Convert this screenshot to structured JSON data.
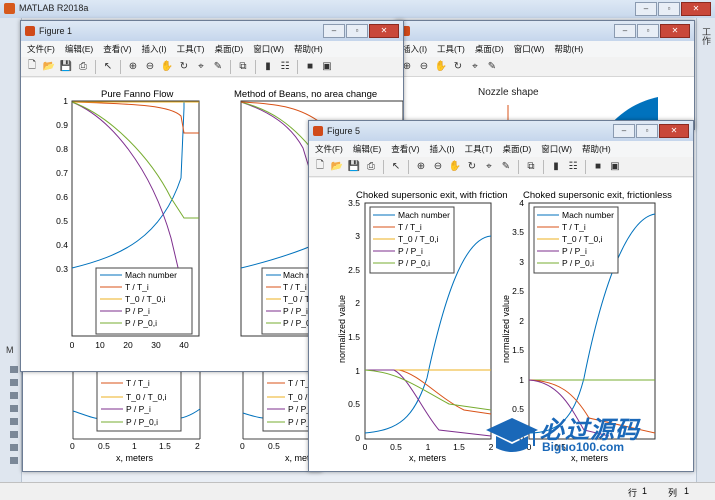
{
  "main_window": {
    "title": "MATLAB R2018a",
    "status_row_label": "行",
    "status_row_value": "1",
    "status_col_label": "列",
    "status_col_value": "1",
    "right_side_label": "工作",
    "left_panel_label": "M"
  },
  "menu": [
    "文件(F)",
    "编辑(E)",
    "查看(V)",
    "插入(I)",
    "工具(T)",
    "桌面(D)",
    "窗口(W)",
    "帮助(H)"
  ],
  "back_figure": {
    "plot_title": "Nozzle shape"
  },
  "figure1": {
    "title": "Figure 1",
    "plots": [
      {
        "title": "Pure Fanno Flow",
        "xticks": [
          "0",
          "10",
          "20",
          "30",
          "40"
        ],
        "yticks": [
          "0.3",
          "0.4",
          "0.5",
          "0.6",
          "0.7",
          "0.8",
          "0.9",
          "1"
        ]
      },
      {
        "title": "Method of Beans, no area change",
        "xticks": [],
        "yticks": []
      }
    ],
    "legend": [
      "Mach number",
      "T / T_i",
      "T_0 / T_0,i",
      "P / P_i",
      "P / P_0,i"
    ]
  },
  "figure_lower": {
    "xticks": [
      "0",
      "0.5",
      "1",
      "1.5",
      "2"
    ],
    "xlabel": "x, meters",
    "legend": [
      "T / T_i",
      "T_0 / T_0,i",
      "P / P_i",
      "P / P_0,i"
    ]
  },
  "figure5": {
    "title": "Figure 5",
    "plots": [
      {
        "title": "Choked supersonic exit, with friction",
        "ylabel": "normalized value",
        "xlabel": "x, meters",
        "xticks": [
          "0",
          "0.5",
          "1",
          "1.5",
          "2"
        ],
        "yticks": [
          "0",
          "0.5",
          "1",
          "1.5",
          "2",
          "2.5",
          "3",
          "3.5"
        ]
      },
      {
        "title": "Choked supersonic exit, frictionless",
        "ylabel": "normalized value",
        "xlabel": "x, meters",
        "xticks": [
          "0",
          "0.5",
          "1",
          "1.5",
          "2"
        ],
        "yticks": [
          "0",
          "0.5",
          "1",
          "1.5",
          "2",
          "2.5",
          "3",
          "3.5",
          "4"
        ]
      }
    ],
    "legend": [
      "Mach number",
      "T / T_i",
      "T_0 / T_0,i",
      "P / P_i",
      "P / P_0,i"
    ]
  },
  "watermark": {
    "main": "必过源码",
    "url": "Biguo100.com"
  },
  "colors": {
    "mach": "#0072bd",
    "t": "#d95319",
    "t0": "#edb120",
    "p": "#7e2f8e",
    "p0": "#77ac30"
  }
}
